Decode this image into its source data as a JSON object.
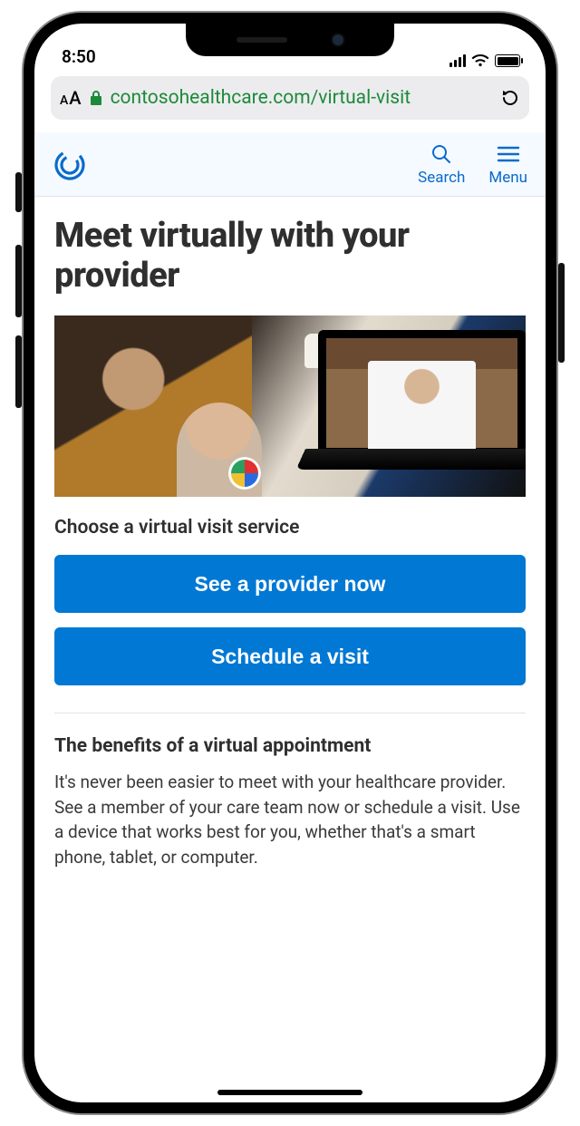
{
  "statusbar": {
    "time": "8:50"
  },
  "browser": {
    "url": "contosohealthcare.com/virtual-visit"
  },
  "header": {
    "search_label": "Search",
    "menu_label": "Menu"
  },
  "hero": {
    "title": "Meet virtually with your provider"
  },
  "service_section": {
    "label": "Choose a virtual visit service",
    "cta_primary": "See a provider now",
    "cta_secondary": "Schedule a visit"
  },
  "benefits": {
    "title": "The benefits of a virtual appointment",
    "body": "It's never been easier to meet with your healthcare provider. See a member of your care team now or schedule a visit. Use a device that works best for you, whether that's a smart phone, tablet, or computer."
  }
}
